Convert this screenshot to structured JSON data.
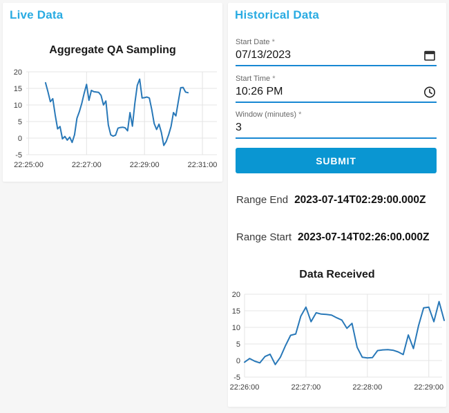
{
  "colors": {
    "accent": "#29ABE2",
    "button": "#0A96D2",
    "underline": "#1787D2",
    "line": "#2878B8",
    "grid": "#E4E4E4",
    "tick_text": "#3C3C3C"
  },
  "live_panel": {
    "title": "Live Data"
  },
  "historical_panel": {
    "title": "Historical Data",
    "fields": {
      "start_date": {
        "label": "Start Date",
        "required_mark": "*",
        "value": "07/13/2023",
        "icon": "calendar-icon"
      },
      "start_time": {
        "label": "Start Time",
        "required_mark": "*",
        "value": "10:26 PM",
        "icon": "clock-icon"
      },
      "window": {
        "label": "Window (minutes)",
        "required_mark": "*",
        "value": "3"
      }
    },
    "submit_label": "SUBMIT",
    "results": {
      "range_end": {
        "label": "Range End",
        "value": "2023-07-14T02:29:00.000Z"
      },
      "range_start": {
        "label": "Range Start",
        "value": "2023-07-14T02:26:00.000Z"
      }
    }
  },
  "chart_data": [
    {
      "id": "live",
      "type": "line",
      "title": "Aggregate QA Sampling",
      "xlabel": "",
      "ylabel": "",
      "grid": true,
      "legend": "none",
      "ylim": [
        -5,
        20
      ],
      "y_ticks": [
        -5,
        0,
        5,
        10,
        15,
        20
      ],
      "x_tick_labels": [
        "22:25:00",
        "22:27:00",
        "22:29:00",
        "22:31:00"
      ],
      "x_tick_seconds": [
        5,
        125,
        245,
        365
      ],
      "axis_span_seconds": 395,
      "start_offset_seconds": 40,
      "interval_seconds": 5,
      "values": [
        16.7,
        14.0,
        11.0,
        11.9,
        7.0,
        2.8,
        3.5,
        -0.2,
        0.5,
        -0.6,
        0.3,
        -1.3,
        1.0,
        6.0,
        8.0,
        10.5,
        13.5,
        16.2,
        11.4,
        14.4,
        14.0,
        13.9,
        13.8,
        12.9,
        10.0,
        11.2,
        4.0,
        1.0,
        0.6,
        0.9,
        3.0,
        3.2,
        3.3,
        3.1,
        2.2,
        7.7,
        3.6,
        10.5,
        15.9,
        17.8,
        12.1,
        12.2,
        12.4,
        12.1,
        8.6,
        4.4,
        2.6,
        4.2,
        1.7,
        -2.2,
        -1.0,
        1.0,
        3.5,
        7.7,
        6.7,
        11.0,
        15.2,
        15.3,
        13.9,
        13.7
      ]
    },
    {
      "id": "received",
      "type": "line",
      "title": "Data Received",
      "xlabel": "",
      "ylabel": "",
      "grid": true,
      "legend": "none",
      "ylim": [
        -5,
        20
      ],
      "y_ticks": [
        -5,
        0,
        5,
        10,
        15,
        20
      ],
      "x_tick_labels": [
        "22:26:00",
        "22:27:00",
        "22:28:00",
        "22:29:00"
      ],
      "x_tick_seconds": [
        0,
        60,
        120,
        180
      ],
      "axis_span_seconds": 193,
      "start_offset_seconds": 0,
      "interval_seconds": 5,
      "values": [
        -0.5,
        0.6,
        -0.2,
        -0.7,
        1.2,
        1.9,
        -1.2,
        1.0,
        4.5,
        7.6,
        8.0,
        13.4,
        16.1,
        11.7,
        14.4,
        14.0,
        13.9,
        13.7,
        12.9,
        12.2,
        9.7,
        11.2,
        4.0,
        1.0,
        0.8,
        0.9,
        3.0,
        3.2,
        3.3,
        3.1,
        2.6,
        1.8,
        7.7,
        3.6,
        10.5,
        15.9,
        16.1,
        11.7,
        17.8,
        12.1
      ]
    }
  ]
}
